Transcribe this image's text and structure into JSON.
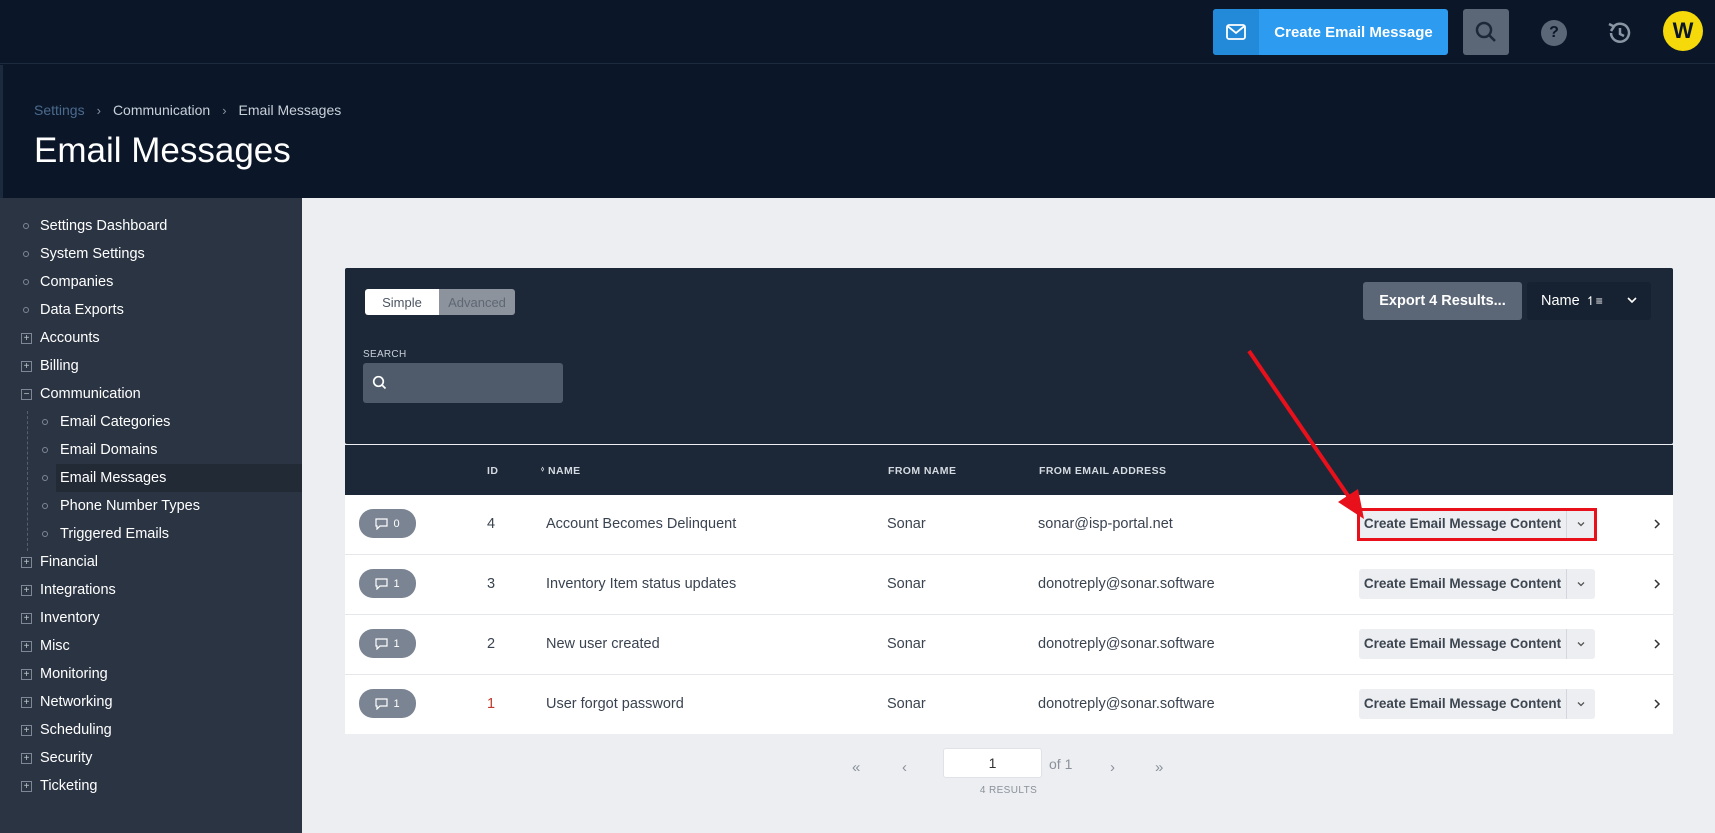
{
  "topbar": {
    "create_label": "Create Email Message",
    "avatar_initial": "W",
    "help_glyph": "?"
  },
  "breadcrumb": {
    "items": [
      "Settings",
      "Communication",
      "Email Messages"
    ],
    "sep": "›"
  },
  "page_title": "Email Messages",
  "sidebar": {
    "items": [
      {
        "label": "Settings Dashboard",
        "kind": "bullet"
      },
      {
        "label": "System Settings",
        "kind": "bullet"
      },
      {
        "label": "Companies",
        "kind": "bullet"
      },
      {
        "label": "Data Exports",
        "kind": "bullet"
      },
      {
        "label": "Accounts",
        "kind": "plus"
      },
      {
        "label": "Billing",
        "kind": "plus"
      },
      {
        "label": "Communication",
        "kind": "minus"
      },
      {
        "label": "Email Categories",
        "kind": "sub"
      },
      {
        "label": "Email Domains",
        "kind": "sub"
      },
      {
        "label": "Email Messages",
        "kind": "sub-active"
      },
      {
        "label": "Phone Number Types",
        "kind": "sub"
      },
      {
        "label": "Triggered Emails",
        "kind": "sub"
      },
      {
        "label": "Financial",
        "kind": "plus"
      },
      {
        "label": "Integrations",
        "kind": "plus"
      },
      {
        "label": "Inventory",
        "kind": "plus"
      },
      {
        "label": "Misc",
        "kind": "plus"
      },
      {
        "label": "Monitoring",
        "kind": "plus"
      },
      {
        "label": "Networking",
        "kind": "plus"
      },
      {
        "label": "Scheduling",
        "kind": "plus"
      },
      {
        "label": "Security",
        "kind": "plus"
      },
      {
        "label": "Ticketing",
        "kind": "plus"
      }
    ]
  },
  "filter": {
    "toggle_simple": "Simple",
    "toggle_advanced": "Advanced",
    "export_label": "Export 4 Results...",
    "sort_label": "Name",
    "sort_icon": "↿≡",
    "search_label": "SEARCH",
    "search_placeholder": ""
  },
  "table": {
    "headers": {
      "id": "ID",
      "name": "NAME",
      "from_name": "FROM NAME",
      "from_email": "FROM EMAIL ADDRESS",
      "sort_mark": "⬨"
    },
    "action_label": "Create Email Message Content",
    "rows": [
      {
        "notes": "0",
        "id": "4",
        "name": "Account Becomes Delinquent",
        "from_name": "Sonar",
        "from_email": "sonar@isp-portal.net"
      },
      {
        "notes": "1",
        "id": "3",
        "name": "Inventory Item status updates",
        "from_name": "Sonar",
        "from_email": "donotreply@sonar.software"
      },
      {
        "notes": "1",
        "id": "2",
        "name": "New user created",
        "from_name": "Sonar",
        "from_email": "donotreply@sonar.software"
      },
      {
        "notes": "1",
        "id": "1",
        "name": "User forgot password",
        "from_name": "Sonar",
        "from_email": "donotreply@sonar.software"
      }
    ]
  },
  "pager": {
    "first": "«",
    "prev": "‹",
    "next": "›",
    "last": "»",
    "page": "1",
    "of": "of 1",
    "results": "4 RESULTS"
  },
  "colors": {
    "accent": "#2d9bf0",
    "annotation": "#e8101a",
    "avatar": "#f5d90a"
  }
}
